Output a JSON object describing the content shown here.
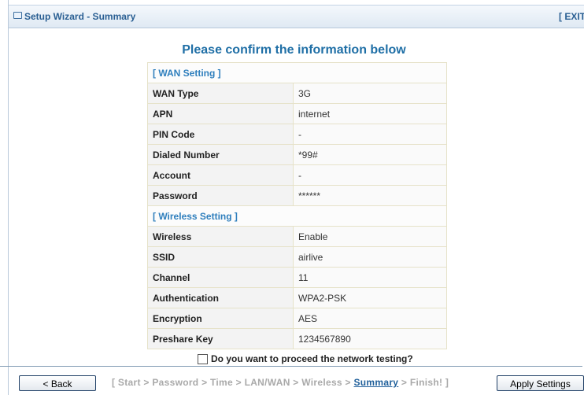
{
  "window": {
    "title": "Setup Wizard - Summary",
    "exit_label": "[ EXIT"
  },
  "heading": "Please confirm the information below",
  "wan_section": {
    "title": "[ WAN Setting ]",
    "rows": [
      {
        "label": "WAN Type",
        "value": "3G"
      },
      {
        "label": "APN",
        "value": "internet"
      },
      {
        "label": "PIN Code",
        "value": "-"
      },
      {
        "label": "Dialed Number",
        "value": "*99#"
      },
      {
        "label": "Account",
        "value": "-"
      },
      {
        "label": "Password",
        "value": "******"
      }
    ]
  },
  "wireless_section": {
    "title": "[ Wireless Setting ]",
    "rows": [
      {
        "label": "Wireless",
        "value": "Enable"
      },
      {
        "label": "SSID",
        "value": "airlive"
      },
      {
        "label": "Channel",
        "value": "11"
      },
      {
        "label": "Authentication",
        "value": "WPA2-PSK"
      },
      {
        "label": "Encryption",
        "value": "AES"
      },
      {
        "label": "Preshare Key",
        "value": "1234567890"
      }
    ]
  },
  "proceed_question": "Do you want to proceed the network testing?",
  "proceed_checked": false,
  "buttons": {
    "back": "< Back",
    "apply": "Apply Settings"
  },
  "steps": {
    "before": "[ Start > Password > Time > LAN/WAN > Wireless >",
    "current": "Summary",
    "after": "> Finish! ]"
  }
}
